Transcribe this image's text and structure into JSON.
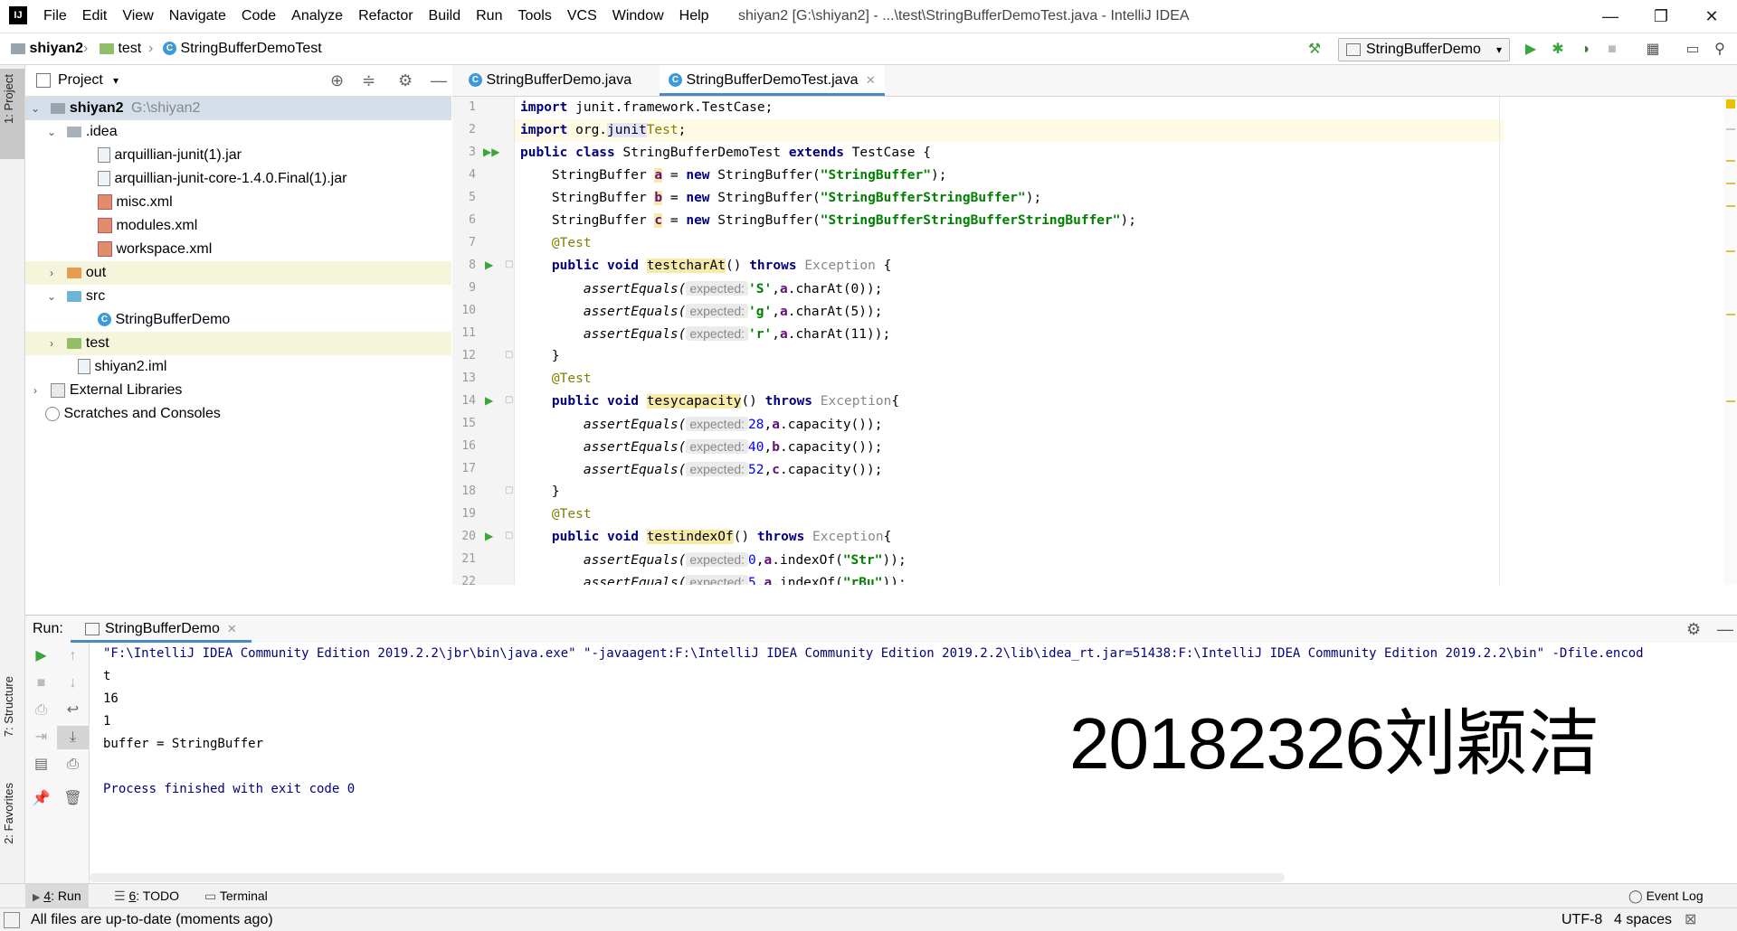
{
  "app": {
    "logo": "IJ",
    "window_title": "shiyan2 [G:\\shiyan2] - ...\\test\\StringBufferDemoTest.java - IntelliJ IDEA",
    "menu": [
      "File",
      "Edit",
      "View",
      "Navigate",
      "Code",
      "Analyze",
      "Refactor",
      "Build",
      "Run",
      "Tools",
      "VCS",
      "Window",
      "Help"
    ]
  },
  "breadcrumb": [
    "shiyan2",
    "test",
    "StringBufferDemoTest"
  ],
  "run_config": "StringBufferDemo",
  "project": {
    "header": "Project",
    "tree": [
      {
        "label": "shiyan2",
        "path": "G:\\shiyan2"
      },
      {
        "label": ".idea"
      },
      {
        "label": "arquillian-junit(1).jar"
      },
      {
        "label": "arquillian-junit-core-1.4.0.Final(1).jar"
      },
      {
        "label": "misc.xml"
      },
      {
        "label": "modules.xml"
      },
      {
        "label": "workspace.xml"
      },
      {
        "label": "out"
      },
      {
        "label": "src"
      },
      {
        "label": "StringBufferDemo"
      },
      {
        "label": "test"
      },
      {
        "label": "shiyan2.iml"
      },
      {
        "label": "External Libraries"
      },
      {
        "label": "Scratches and Consoles"
      }
    ]
  },
  "editor": {
    "tabs": [
      "StringBufferDemo.java",
      "StringBufferDemoTest.java"
    ],
    "lines": [
      "1",
      "2",
      "3",
      "4",
      "5",
      "6",
      "7",
      "8",
      "9",
      "10",
      "11",
      "12",
      "13",
      "14",
      "15",
      "16",
      "17",
      "18",
      "19",
      "20",
      "21",
      "22"
    ],
    "hint": "expected:"
  },
  "code": {
    "l1": {
      "kw": "import",
      "rest": " junit.framework.TestCase;"
    },
    "l2": {
      "kw": "import",
      "a": " org.",
      "b": "junit",
      ".": ".",
      "c": "Test",
      ";": ";"
    },
    "l3": {
      "kw1": "public class",
      "name": " StringBufferDemoTest ",
      "kw2": "extends",
      "rest": " TestCase {"
    },
    "l4": {
      "t": "    StringBuffer ",
      "v": "a",
      "e": " = ",
      "kw": "new",
      "c": " StringBuffer(",
      "s": "\"StringBuffer\"",
      "end": ");"
    },
    "l5": {
      "t": "    StringBuffer ",
      "v": "b",
      "e": " = ",
      "kw": "new",
      "c": " StringBuffer(",
      "s": "\"StringBufferStringBuffer\"",
      "end": ");"
    },
    "l6": {
      "t": "    StringBuffer ",
      "v": "c",
      "e": " = ",
      "kw": "new",
      "c": " StringBuffer(",
      "s": "\"StringBufferStringBufferStringBuffer\"",
      "end": ");"
    },
    "l7": "    @Test",
    "l8": {
      "kw": "    public void ",
      "m": "testcharAt",
      "p": "() ",
      "kw2": "throws",
      "e": " Exception",
      "end": " {"
    },
    "l9": {
      "call": "        assertEquals(",
      "arg": "'S'",
      ",": ",",
      "v": "a",
      "rest": ".charAt(0));"
    },
    "l10": {
      "call": "        assertEquals(",
      "arg": "'g'",
      ",": ",",
      "v": "a",
      "rest": ".charAt(5));"
    },
    "l11": {
      "call": "        assertEquals(",
      "arg": "'r'",
      ",": ",",
      "v": "a",
      "rest": ".charAt(11));"
    },
    "l12": "    }",
    "l13": "    @Test",
    "l14": {
      "kw": "    public void ",
      "m": "tesycapacity",
      "p": "() ",
      "kw2": "throws",
      "e": " Exception",
      "end": "{"
    },
    "l15": {
      "call": "        assertEquals(",
      "arg": "28",
      ",": ",",
      "v": "a",
      "rest": ".capacity());"
    },
    "l16": {
      "call": "        assertEquals(",
      "arg": "40",
      ",": ",",
      "v": "b",
      "rest": ".capacity());"
    },
    "l17": {
      "call": "        assertEquals(",
      "arg": "52",
      ",": ",",
      "v": "c",
      "rest": ".capacity());"
    },
    "l18": "    }",
    "l19": "    @Test",
    "l20": {
      "kw": "    public void ",
      "m": "testindexOf",
      "p": "() ",
      "kw2": "throws",
      "e": " Exception",
      "end": "{"
    },
    "l21": {
      "call": "        assertEquals(",
      "arg": "0",
      ",": ",",
      "v": "a",
      "m": ".indexOf(",
      "s": "\"Str\"",
      "end": "));"
    },
    "l22": {
      "call": "        assertEquals(",
      "arg": "5",
      ",": ",",
      "v": "a",
      "m": ".indexOf(",
      "s": "\"rBu\"",
      "end": "));"
    }
  },
  "run": {
    "label": "Run:",
    "tab": "StringBufferDemo",
    "console": [
      "\"F:\\IntelliJ IDEA Community Edition 2019.2.2\\jbr\\bin\\java.exe\" \"-javaagent:F:\\IntelliJ IDEA Community Edition 2019.2.2\\lib\\idea_rt.jar=51438:F:\\IntelliJ IDEA Community Edition 2019.2.2\\bin\" -Dfile.encod",
      "t",
      "16",
      "1",
      "buffer = StringBuffer",
      "",
      "Process finished with exit code 0"
    ]
  },
  "watermark": "20182326刘颖洁",
  "side_tabs": {
    "project": "1: Project",
    "structure": "7: Structure",
    "favorites": "2: Favorites"
  },
  "bottom_tabs": [
    {
      "num": "4",
      "label": ": Run"
    },
    {
      "num": "6",
      "label": ": TODO"
    },
    {
      "num": "",
      "label": "Terminal"
    }
  ],
  "event_log": "Event Log",
  "status": {
    "message": "All files are up-to-date (moments ago)",
    "encoding": "UTF-8",
    "indent": "4 spaces"
  }
}
